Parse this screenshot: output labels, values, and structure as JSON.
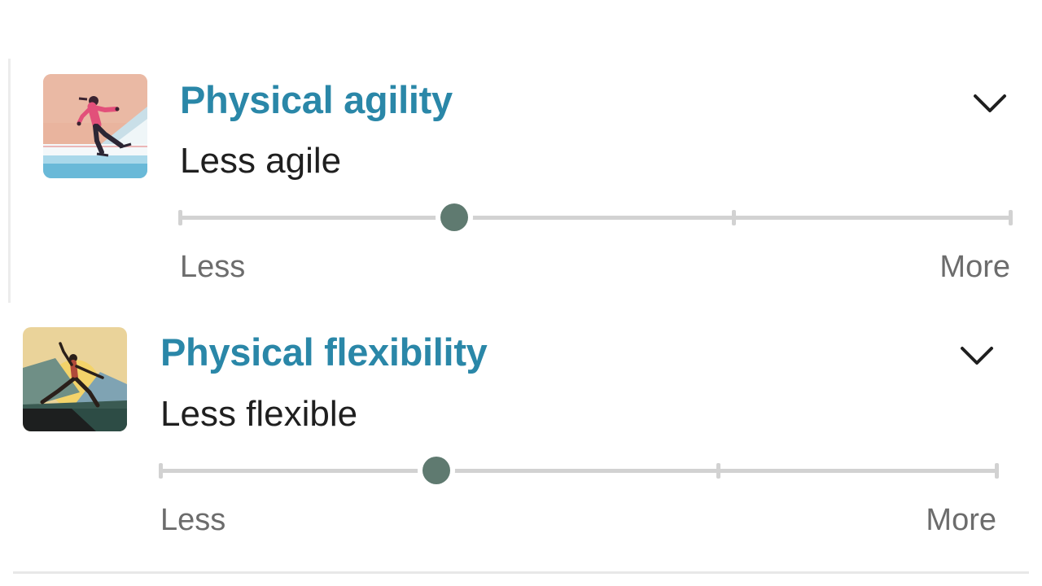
{
  "items": [
    {
      "title": "Physical agility",
      "value_label": "Less agile",
      "scale_min_label": "Less",
      "scale_max_label": "More",
      "level_fraction": 0.33,
      "stops": 4,
      "image_icon": "ice-skater-illustration",
      "expand_icon": "chevron-down-icon"
    },
    {
      "title": "Physical flexibility",
      "value_label": "Less flexible",
      "scale_min_label": "Less",
      "scale_max_label": "More",
      "level_fraction": 0.33,
      "stops": 4,
      "image_icon": "dancer-pose-illustration",
      "expand_icon": "chevron-down-icon"
    }
  ],
  "colors": {
    "title": "#2a87a8",
    "slider_thumb": "#5f7a70",
    "slider_track": "#d2d2d2",
    "value_text": "#1f1f1f",
    "scale_text": "#6c6c6c"
  }
}
